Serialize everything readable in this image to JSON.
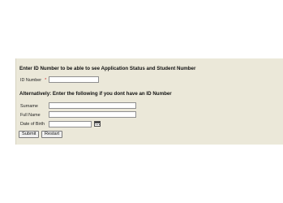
{
  "form": {
    "heading_id": "Enter ID Number to be able to see Application Status and Student Number",
    "id_label": "ID Number",
    "required_mark": "*",
    "id_value": "",
    "heading_alt": "Alternatively: Enter the following if you dont have an ID Number",
    "surname_label": "Surname",
    "surname_value": "",
    "fullname_label": "Full Name",
    "fullname_value": "",
    "dob_label": "Date of Birth",
    "dob_value": "",
    "calendar_icon": "calendar-icon",
    "submit_label": "Submit",
    "restart_label": "Restart"
  },
  "colors": {
    "panel_background": "#ebe8d9",
    "required_mark": "#cc2a2a"
  }
}
